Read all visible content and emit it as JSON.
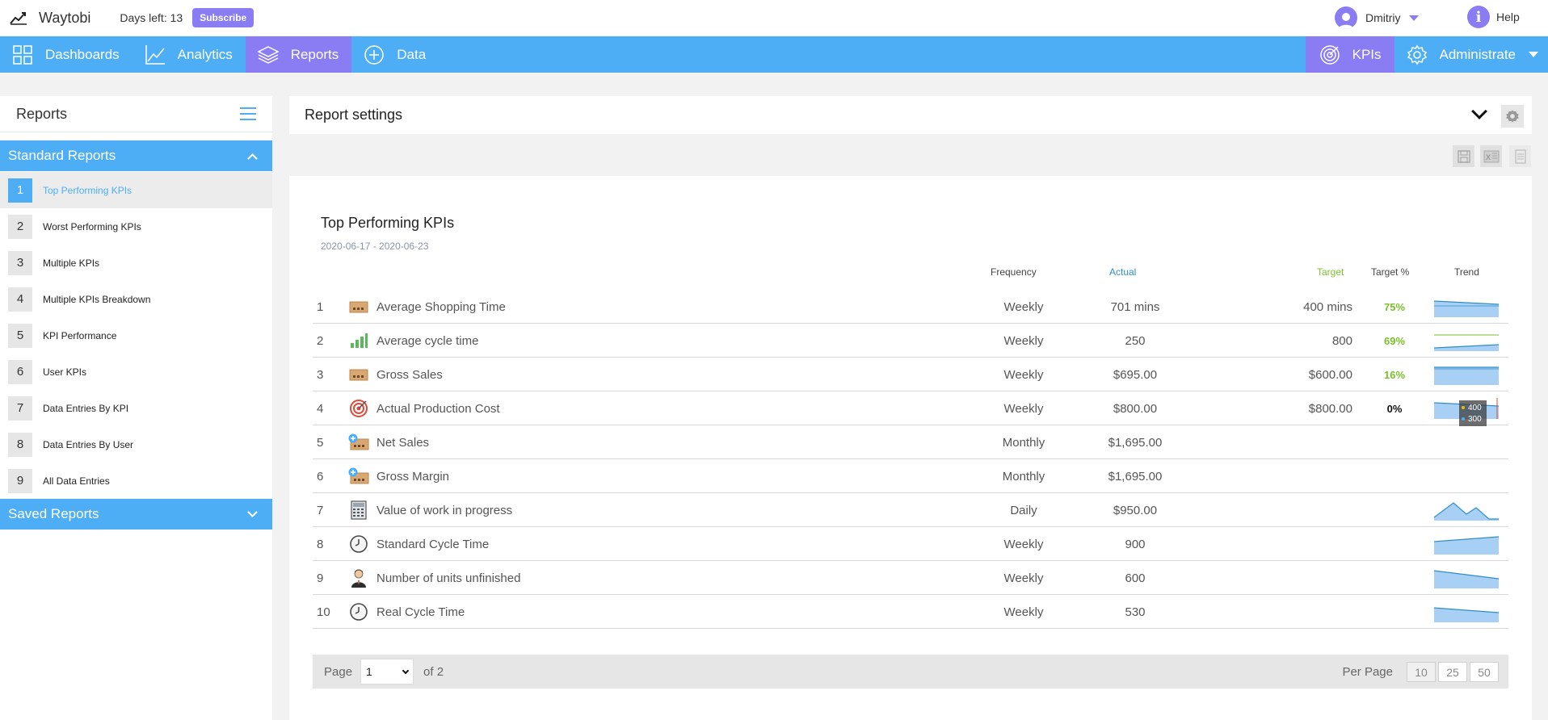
{
  "topbar": {
    "brand": "Waytobi",
    "days_left": "Days left: 13",
    "subscribe_label": "Subscribe",
    "user_name": "Dmitriy",
    "help_label": "Help"
  },
  "nav": {
    "items": [
      {
        "label": "Dashboards",
        "icon": "grid-icon"
      },
      {
        "label": "Analytics",
        "icon": "chart-icon"
      },
      {
        "label": "Reports",
        "icon": "layers-icon"
      },
      {
        "label": "Data",
        "icon": "plus-circle-icon"
      }
    ],
    "kpis_label": "KPIs",
    "administrate_label": "Administrate"
  },
  "sidebar": {
    "title": "Reports",
    "standard_section": "Standard Reports",
    "saved_section": "Saved Reports",
    "items": [
      {
        "num": "1",
        "label": "Top Performing KPIs"
      },
      {
        "num": "2",
        "label": "Worst Performing KPIs"
      },
      {
        "num": "3",
        "label": "Multiple KPIs"
      },
      {
        "num": "4",
        "label": "Multiple KPIs Breakdown"
      },
      {
        "num": "5",
        "label": "KPI Performance"
      },
      {
        "num": "6",
        "label": "User KPIs"
      },
      {
        "num": "7",
        "label": "Data Entries By KPI"
      },
      {
        "num": "8",
        "label": "Data Entries By User"
      },
      {
        "num": "9",
        "label": "All Data Entries"
      }
    ]
  },
  "settings": {
    "title": "Report settings"
  },
  "report": {
    "title": "Top Performing KPIs",
    "range": "2020-06-17 - 2020-06-23",
    "columns": {
      "frequency": "Frequency",
      "actual": "Actual",
      "target": "Target",
      "target_pct": "Target %",
      "trend": "Trend"
    },
    "rows": [
      {
        "num": "1",
        "icon": "money-icon",
        "name": "Average Shopping Time",
        "frequency": "Weekly",
        "actual": "701 mins",
        "target": "400 mins",
        "pct": "75%",
        "trend": "flat-down"
      },
      {
        "num": "2",
        "icon": "bar-chart-icon",
        "name": "Average cycle time",
        "frequency": "Weekly",
        "actual": "250",
        "target": "800",
        "pct": "69%",
        "trend": "line-up"
      },
      {
        "num": "3",
        "icon": "money-icon",
        "name": "Gross Sales",
        "frequency": "Weekly",
        "actual": "$695.00",
        "target": "$600.00",
        "pct": "16%",
        "trend": "flat"
      },
      {
        "num": "4",
        "icon": "target-icon",
        "name": "Actual Production Cost",
        "frequency": "Weekly",
        "actual": "$800.00",
        "target": "$800.00",
        "pct": "0%",
        "trend": "flat-down"
      },
      {
        "num": "5",
        "icon": "money-plus-icon",
        "name": "Net Sales",
        "frequency": "Monthly",
        "actual": "$1,695.00",
        "target": "",
        "pct": "",
        "trend": "none"
      },
      {
        "num": "6",
        "icon": "money-plus-icon",
        "name": "Gross Margin",
        "frequency": "Monthly",
        "actual": "$1,695.00",
        "target": "",
        "pct": "",
        "trend": "none"
      },
      {
        "num": "7",
        "icon": "calculator-icon",
        "name": "Value of work in progress",
        "frequency": "Daily",
        "actual": "$950.00",
        "target": "",
        "pct": "",
        "trend": "peaks"
      },
      {
        "num": "8",
        "icon": "clock-icon",
        "name": "Standard Cycle Time",
        "frequency": "Weekly",
        "actual": "900",
        "target": "",
        "pct": "",
        "trend": "up"
      },
      {
        "num": "9",
        "icon": "person-icon",
        "name": "Number of units unfinished",
        "frequency": "Weekly",
        "actual": "600",
        "target": "",
        "pct": "",
        "trend": "down"
      },
      {
        "num": "10",
        "icon": "clock-icon",
        "name": "Real Cycle Time",
        "frequency": "Weekly",
        "actual": "530",
        "target": "",
        "pct": "",
        "trend": "down"
      }
    ],
    "tooltip": {
      "value_a": "400",
      "value_b": "300"
    }
  },
  "pager": {
    "page_label": "Page",
    "current_page": "1",
    "of_label": "of 2",
    "per_page_label": "Per Page",
    "per_page_options": [
      "10",
      "25",
      "50"
    ]
  },
  "colors": {
    "nav_blue": "#4daef5",
    "active_purple": "#8a7cf2",
    "target_green": "#7ac22a",
    "actual_blue": "#2f8ec9"
  }
}
